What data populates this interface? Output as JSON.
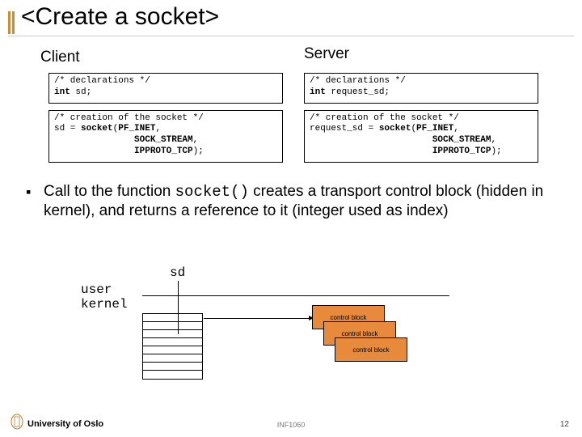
{
  "title": "<Create a socket>",
  "labels": {
    "client": "Client",
    "server": "Server",
    "user": "user",
    "kernel": "kernel",
    "sd": "sd",
    "control_block": "control block"
  },
  "code": {
    "client_decl_c": "/* declarations */",
    "client_decl_2a": "int",
    "client_decl_2b": " sd;",
    "client_create_c": "/* creation of the socket */",
    "client_create_2a": "sd = ",
    "client_create_2b": "socket",
    "client_create_2c": "(",
    "client_create_2d": "PF_INET",
    "client_create_2e": ",",
    "client_create_3": "               SOCK_STREAM",
    "client_create_3e": ",",
    "client_create_4": "               IPPROTO_TCP",
    "client_create_4e": ");",
    "server_decl_c": "/* declarations */",
    "server_decl_2a": "int",
    "server_decl_2b": " request_sd;",
    "server_create_c": "/* creation of the socket */",
    "server_create_2a": "request_sd = ",
    "server_create_2b": "socket",
    "server_create_2c": "(",
    "server_create_2d": "PF_INET",
    "server_create_2e": ",",
    "server_create_3": "                       SOCK_STREAM",
    "server_create_3e": ",",
    "server_create_4": "                       IPPROTO_TCP",
    "server_create_4e": ");"
  },
  "body": {
    "p1a": "Call to the function ",
    "p1_mono": "socket()",
    "p1b": " creates a transport  control block (hidden in kernel), and returns a reference to it (integer used as index)"
  },
  "footer": {
    "uni": "University of Oslo",
    "course": "INF1060",
    "page": "12"
  }
}
